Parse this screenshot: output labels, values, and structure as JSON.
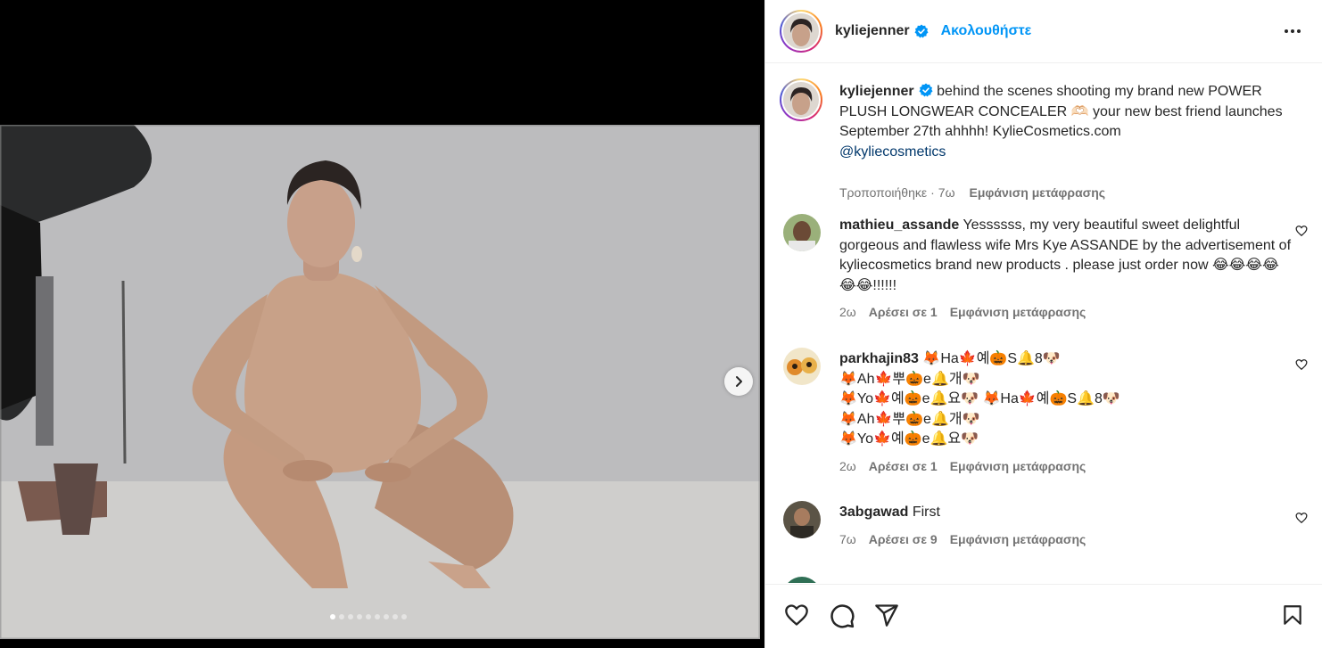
{
  "post": {
    "username": "kyliejenner",
    "follow_label": "Ακολουθήστε",
    "caption": {
      "text_1": "behind the scenes shooting my brand new POWER PLUSH LONGWEAR CONCEALER",
      "emoji": "🫶🏻",
      "text_2": "your new best friend launches September 27th ahhhh! KylieCosmetics.com",
      "mention": "@kyliecosmetics",
      "edited_label": "Τροποποιήθηκε",
      "time": "7ω",
      "translate_label": "Εμφάνιση μετάφρασης"
    },
    "carousel": {
      "count": 9,
      "active_index": 0
    }
  },
  "comments": [
    {
      "username": "mathieu_assande",
      "text": "Yessssss, my very beautiful sweet delightful gorgeous and flawless wife Mrs Kye ASSANDE by the advertisement of kyliecosmetics brand new products . please just order now 😂😂😂😂😂😂!!!!!!",
      "time": "2ω",
      "likes": "Αρέσει σε 1",
      "translate": "Εμφάνιση μετάφρασης"
    },
    {
      "username": "parkhajin83",
      "lines": [
        "🦊Ha🍁예🎃S🔔8🐶",
        "🦊Ah🍁뿌🎃e🔔개🐶",
        "🦊Yo🍁예🎃e🔔요🐶 🦊Ha🍁예🎃S🔔8🐶",
        "🦊Ah🍁뿌🎃e🔔개🐶",
        "🦊Yo🍁예🎃e🔔요🐶"
      ],
      "time": "2ω",
      "likes": "Αρέσει σε 1",
      "translate": "Εμφάνιση μετάφρασης"
    },
    {
      "username": "3abgawad",
      "text": "First",
      "time": "7ω",
      "likes": "Αρέσει σε 9",
      "translate": "Εμφάνιση μετάφρασης"
    }
  ],
  "icons": {
    "more": "more-options-icon",
    "verified": "verified-badge-icon",
    "next": "chevron-right-icon",
    "like": "heart-icon",
    "comment": "comment-icon",
    "share": "share-icon",
    "save": "bookmark-icon"
  },
  "colors": {
    "accent": "#0095f6",
    "verified": "#0095f6",
    "text": "#262626",
    "muted": "#737373"
  }
}
